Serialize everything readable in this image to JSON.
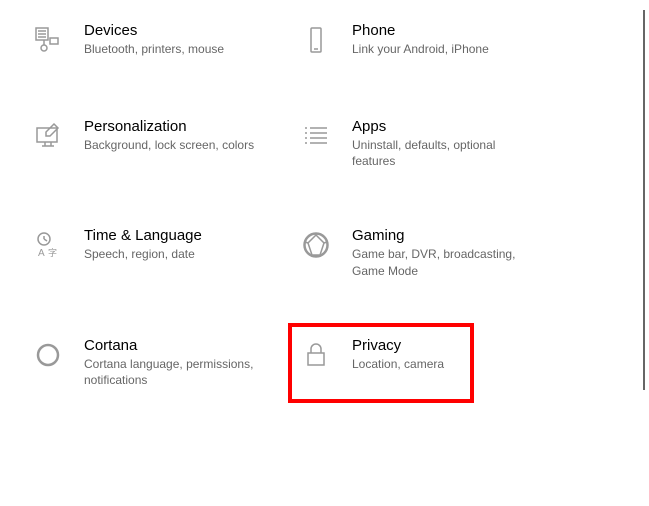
{
  "tiles": [
    {
      "id": "devices",
      "title": "Devices",
      "desc": "Bluetooth, printers, mouse"
    },
    {
      "id": "phone",
      "title": "Phone",
      "desc": "Link your Android, iPhone"
    },
    {
      "id": "personalization",
      "title": "Personalization",
      "desc": "Background, lock screen, colors"
    },
    {
      "id": "apps",
      "title": "Apps",
      "desc": "Uninstall, defaults, optional features"
    },
    {
      "id": "time-language",
      "title": "Time & Language",
      "desc": "Speech, region, date"
    },
    {
      "id": "gaming",
      "title": "Gaming",
      "desc": "Game bar, DVR, broadcasting, Game Mode"
    },
    {
      "id": "cortana",
      "title": "Cortana",
      "desc": "Cortana language, permissions, notifications"
    },
    {
      "id": "privacy",
      "title": "Privacy",
      "desc": "Location, camera"
    }
  ],
  "highlighted": "privacy"
}
